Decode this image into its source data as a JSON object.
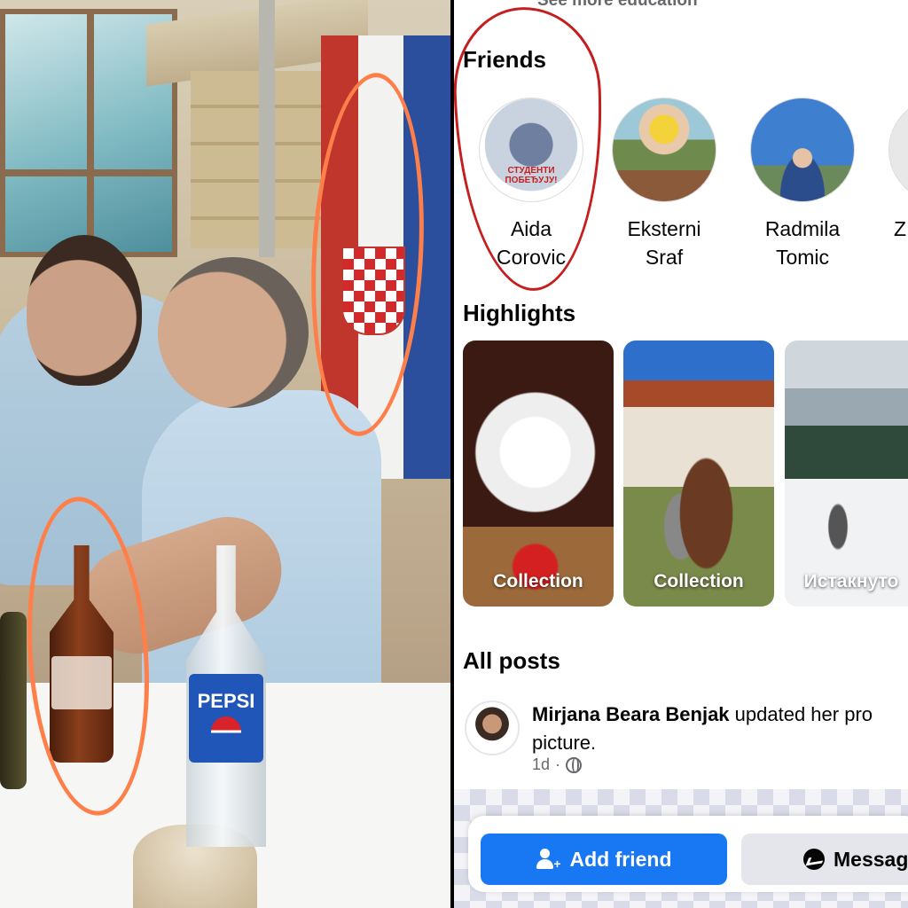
{
  "photo": {
    "bottle_brand": "PEPSI"
  },
  "profile": {
    "see_more": "See more education",
    "friends_title": "Friends",
    "friends": [
      {
        "first": "Aida",
        "last": "Corovic",
        "avatar_text": "СТУДЕНТИ ПОБЕЂУЈУ!"
      },
      {
        "first": "Eksterni",
        "last": "Sraf"
      },
      {
        "first": "Radmila",
        "last": "Tomic"
      },
      {
        "first": "Z",
        "last": ""
      }
    ],
    "highlights_title": "Highlights",
    "highlights": [
      {
        "label": "Collection"
      },
      {
        "label": "Collection"
      },
      {
        "label": "Истакнуто"
      }
    ],
    "all_posts_title": "All posts",
    "post": {
      "author": "Mirjana Beara Benjak",
      "action_line1": " updated her pro",
      "action_line2": "picture.",
      "time": "1d"
    },
    "actions": {
      "add_friend": "Add friend",
      "message": "Messag"
    },
    "colors": {
      "primary": "#1877f2",
      "annotation_red": "#c41e1e",
      "annotation_orange": "#ff7f4a"
    }
  }
}
